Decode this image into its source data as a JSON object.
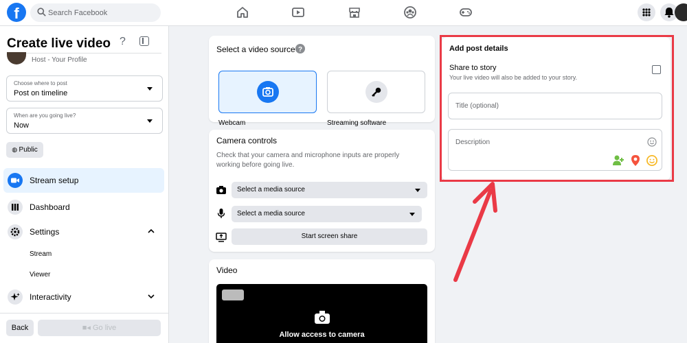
{
  "topbar": {
    "search_placeholder": "Search Facebook",
    "icons": [
      "facebook-logo",
      "search-icon",
      "home-icon",
      "watch-icon",
      "marketplace-icon",
      "groups-icon",
      "gaming-icon",
      "menu-grid-icon",
      "notifications-icon",
      "profile-avatar"
    ]
  },
  "sidebar": {
    "title": "Create live video",
    "host": "Host - Your Profile",
    "where_to_post": {
      "caption": "Choose where to post",
      "value": "Post on timeline"
    },
    "when_live": {
      "caption": "When are you going live?",
      "value": "Now"
    },
    "privacy": "Public",
    "menu": [
      {
        "label": "Stream setup",
        "icon": "camera-icon"
      },
      {
        "label": "Dashboard",
        "icon": "dashboard-icon"
      },
      {
        "label": "Settings",
        "icon": "gear-icon"
      },
      {
        "label": "Interactivity",
        "icon": "sparkle-icon"
      }
    ],
    "settings_sub": [
      "Stream",
      "Viewer"
    ],
    "back_label": "Back",
    "golive_label": "Go live"
  },
  "video_source": {
    "title": "Select a video source",
    "options": [
      {
        "label": "Webcam",
        "icon": "camera-icon",
        "selected": true
      },
      {
        "label": "Streaming software",
        "icon": "key-icon",
        "selected": false
      }
    ]
  },
  "camera_controls": {
    "title": "Camera controls",
    "description": "Check that your camera and microphone inputs are properly working before going live.",
    "camera_select": "Select a media source",
    "mic_select": "Select a media source",
    "screen_share": "Start screen share"
  },
  "video": {
    "title": "Video",
    "allow_text": "Allow access to camera"
  },
  "post_details": {
    "title": "Add post details",
    "share_label": "Share to story",
    "share_sub": "Your live video will also be added to your story.",
    "title_placeholder": "Title (optional)",
    "description_placeholder": "Description"
  },
  "colors": {
    "brand": "#1877f2",
    "highlight": "#ea3a46",
    "tag_people": "#6fbe44",
    "location": "#f5533d",
    "feeling": "#f7b928"
  }
}
